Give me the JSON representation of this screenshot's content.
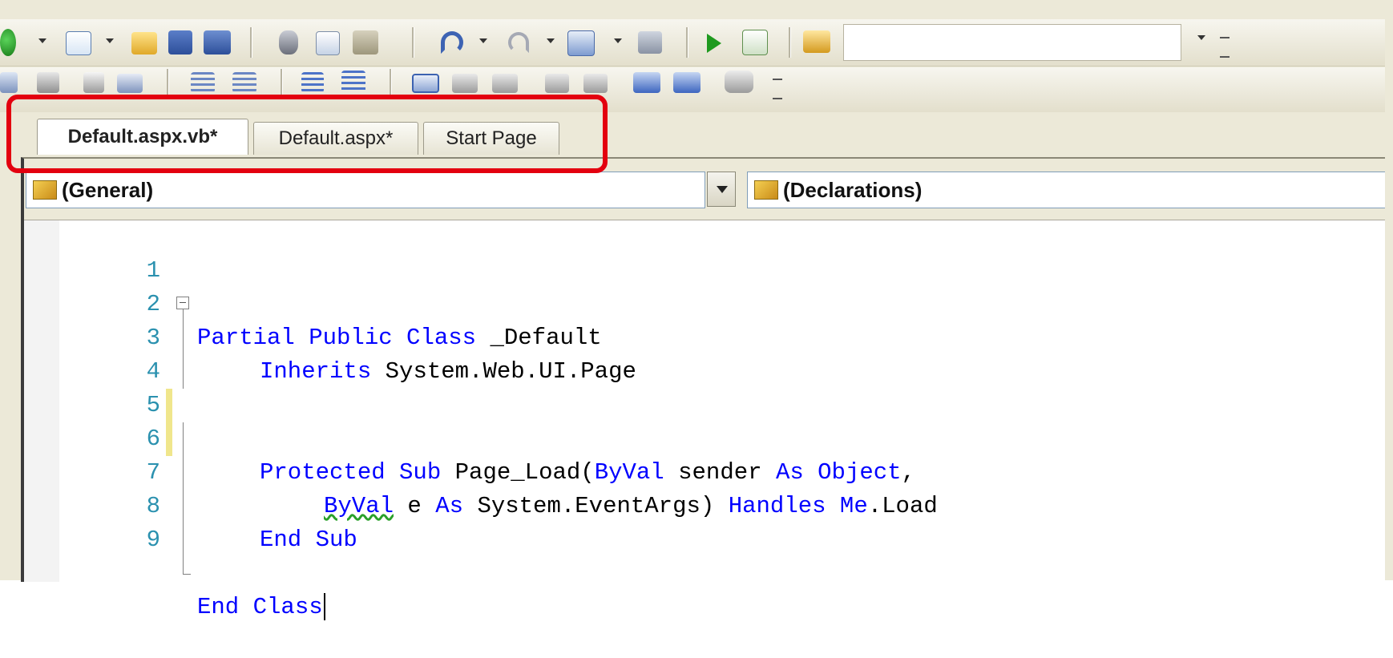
{
  "toolbar1": {
    "icons": [
      "globe-icon",
      "new-project-icon",
      "open-file-icon",
      "save-icon",
      "save-all-icon",
      "cut-icon",
      "copy-icon",
      "paste-icon",
      "undo-icon",
      "redo-icon",
      "navigate-icon",
      "find-icon",
      "start-debug-icon",
      "find-in-files-icon",
      "tools-icon"
    ],
    "combo_value": ""
  },
  "toolbar2": {
    "icons": [
      "toolbar2-icon-1",
      "toolbar2-icon-2",
      "pointer-icon",
      "font-size-icon",
      "outdent-icon",
      "indent-icon",
      "comment-icon",
      "uncomment-icon",
      "bookmark-icon",
      "bookmark-prev-icon",
      "bookmark-next-icon",
      "bookmark-folder-icon",
      "bookmark-folder-next-icon",
      "bookmark-clear-icon",
      "properties-icon",
      "comment-bubble-icon"
    ]
  },
  "tabs": [
    {
      "label": "Default.aspx.vb*",
      "active": true
    },
    {
      "label": "Default.aspx*",
      "active": false
    },
    {
      "label": "Start Page",
      "active": false
    }
  ],
  "navbar": {
    "left": "(General)",
    "right": "(Declarations)"
  },
  "code_lines": [
    {
      "num": "1"
    },
    {
      "num": "2"
    },
    {
      "num": "3"
    },
    {
      "num": "4"
    },
    {
      "num": "5"
    },
    {
      "num": "6"
    },
    {
      "num": "7"
    },
    {
      "num": "8"
    },
    {
      "num": "9"
    }
  ],
  "code": {
    "l1_kw": "Partial Public Class",
    "l1_rest": " _Default",
    "l2_kw": "Inherits",
    "l2_rest": " System.Web.UI.Page",
    "l4_kw1": "Protected Sub",
    "l4_mid": " Page_Load(",
    "l4_kw2": "ByVal",
    "l4_mid2": " sender ",
    "l4_kw3": "As Object",
    "l4_end": ",",
    "l5_kw1": "ByVal",
    "l5_mid": " e ",
    "l5_kw2": "As",
    "l5_mid2": " System.EventArgs) ",
    "l5_kw3": "Handles Me",
    "l5_end": ".Load",
    "l7_kw": "End Sub",
    "l9_kw": "End Class"
  },
  "colors": {
    "highlight": "#e3000f",
    "keyword": "#0000ff",
    "line_number": "#2b91af",
    "change_bar_saved": "#5fb85f",
    "change_bar_unsaved": "#f0e68c"
  }
}
